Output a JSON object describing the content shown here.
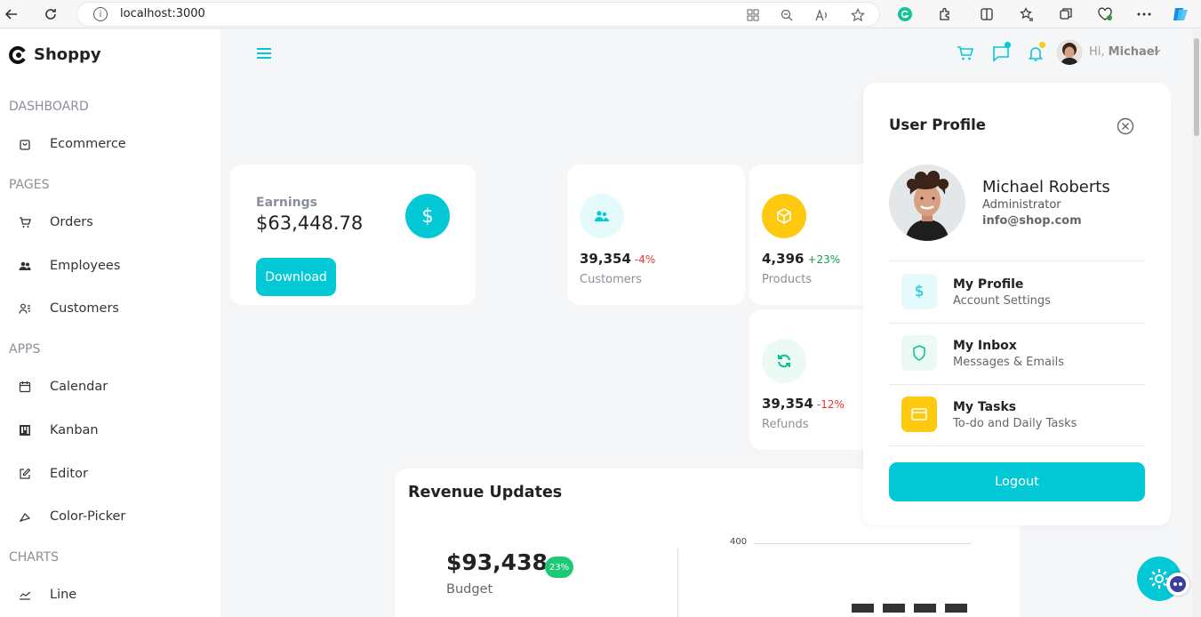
{
  "browser": {
    "url": "localhost:3000"
  },
  "sidebar": {
    "brand": "Shoppy",
    "sections": [
      {
        "title": "DASHBOARD",
        "items": [
          {
            "label": "Ecommerce",
            "icon": "bag-icon"
          }
        ]
      },
      {
        "title": "PAGES",
        "items": [
          {
            "label": "Orders",
            "icon": "cart-icon"
          },
          {
            "label": "Employees",
            "icon": "people-icon"
          },
          {
            "label": "Customers",
            "icon": "person-list-icon"
          }
        ]
      },
      {
        "title": "APPS",
        "items": [
          {
            "label": "Calendar",
            "icon": "calendar-icon"
          },
          {
            "label": "Kanban",
            "icon": "kanban-icon"
          },
          {
            "label": "Editor",
            "icon": "edit-icon"
          },
          {
            "label": "Color-Picker",
            "icon": "color-picker-icon"
          }
        ]
      },
      {
        "title": "CHARTS",
        "items": [
          {
            "label": "Line",
            "icon": "line-chart-icon"
          }
        ]
      }
    ]
  },
  "navbar": {
    "greeting": "Hi,",
    "user_short": "Michael"
  },
  "earnings": {
    "label": "Earnings",
    "value": "$63,448.78",
    "button": "Download"
  },
  "stats": {
    "customers": {
      "value": "39,354",
      "pct": "-4%",
      "label": "Customers",
      "pct_color": "#e33"
    },
    "products": {
      "value": "4,396",
      "pct": "+23%",
      "label": "Products",
      "pct_color": "#1a9e4b"
    },
    "refunds": {
      "value": "39,354",
      "pct": "-12%",
      "label": "Refunds",
      "pct_color": "#e33"
    }
  },
  "revenue": {
    "title": "Revenue Updates",
    "budget_value": "$93,438",
    "budget_badge": "23%",
    "budget_label": "Budget",
    "axis_tick": "400"
  },
  "profile": {
    "title": "User Profile",
    "name": "Michael Roberts",
    "role": "Administrator",
    "email": "info@shop.com",
    "items": [
      {
        "title": "My Profile",
        "desc": "Account Settings",
        "icon": "dollar-icon",
        "bg": "#e5fafb",
        "fg": "#03c9d7"
      },
      {
        "title": "My Inbox",
        "desc": "Messages & Emails",
        "icon": "shield-icon",
        "bg": "#ebfaf2",
        "fg": "#00c292"
      },
      {
        "title": "My Tasks",
        "desc": "To-do and Daily Tasks",
        "icon": "card-icon",
        "bg": "#fec90f",
        "fg": "#fff"
      }
    ],
    "logout": "Logout"
  },
  "colors": {
    "accent": "#03c9d7"
  }
}
